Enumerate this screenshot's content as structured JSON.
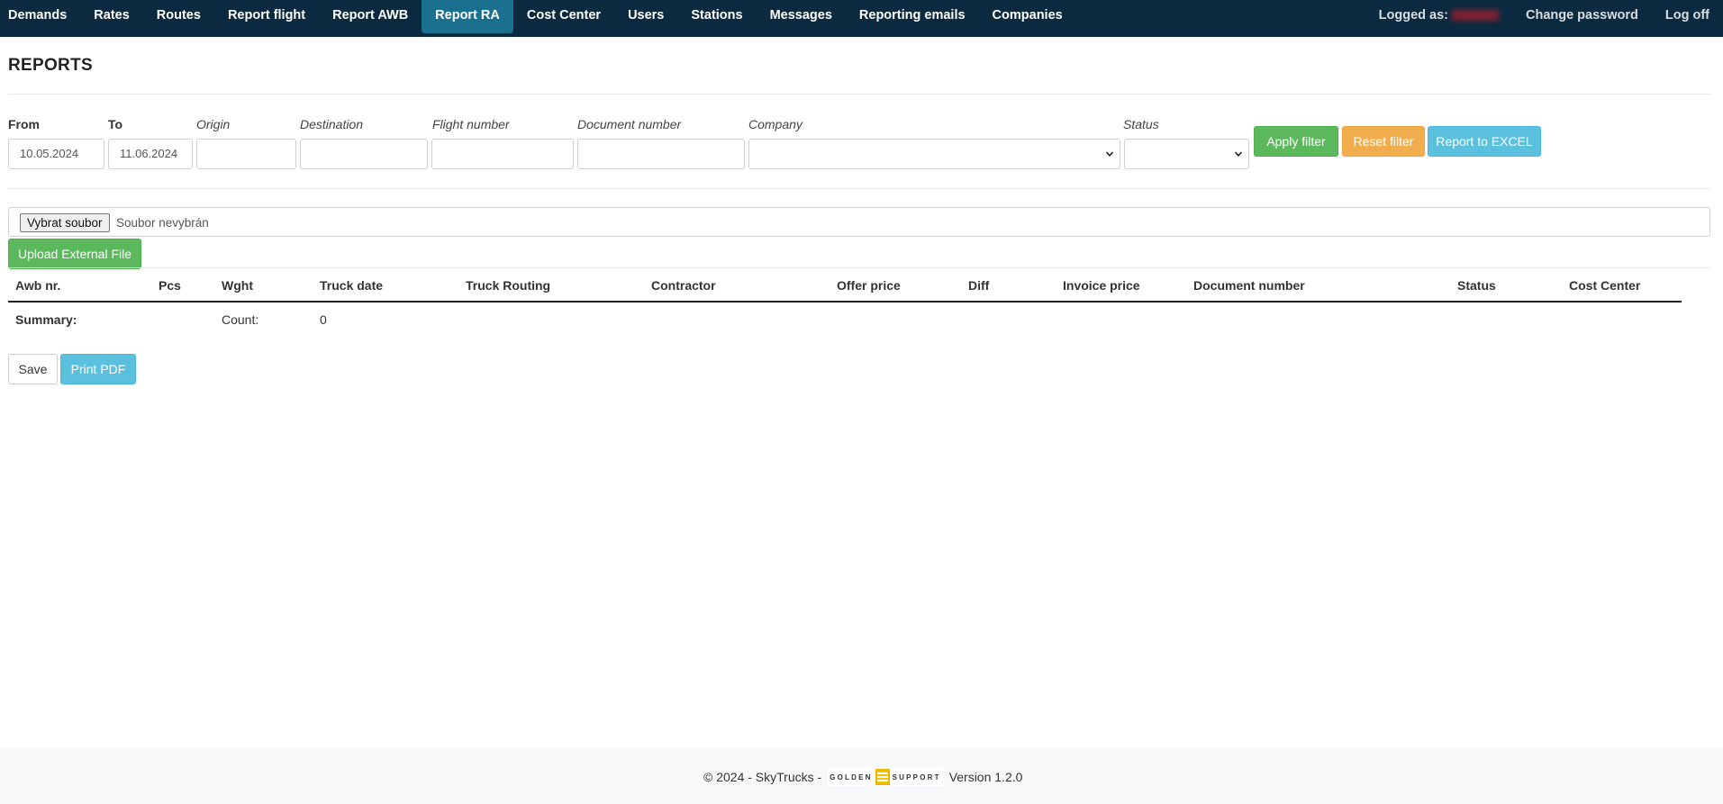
{
  "nav": {
    "items": [
      "Demands",
      "Rates",
      "Routes",
      "Report flight",
      "Report AWB",
      "Report RA",
      "Cost Center",
      "Users",
      "Stations",
      "Messages",
      "Reporting emails",
      "Companies"
    ],
    "active": "Report RA",
    "logged_as": "Logged as:",
    "change_password": "Change password",
    "log_off": "Log off"
  },
  "page_title": "REPORTS",
  "filter": {
    "from_label": "From",
    "to_label": "To",
    "origin_label": "Origin",
    "destination_label": "Destination",
    "flight_number_label": "Flight number",
    "document_number_label": "Document number",
    "company_label": "Company",
    "status_label": "Status",
    "from_value": "10.05.2024",
    "to_value": "11.06.2024",
    "origin_value": "",
    "destination_value": "",
    "flight_number_value": "",
    "document_number_value": "",
    "company_value": "",
    "status_value": "",
    "apply": "Apply filter",
    "reset": "Reset filter",
    "excel": "Report to EXCEL"
  },
  "upload": {
    "choose_file": "Vybrat soubor",
    "no_file": "Soubor nevybrán",
    "upload_button": "Upload External File"
  },
  "table": {
    "columns": [
      "Awb nr.",
      "Pcs",
      "Wght",
      "Truck date",
      "Truck Routing",
      "Contractor",
      "Offer price",
      "Diff",
      "Invoice price",
      "Document number",
      "Status",
      "Cost Center"
    ],
    "summary_label": "Summary:",
    "count_label": "Count:",
    "count_value": "0"
  },
  "actions": {
    "save": "Save",
    "print_pdf": "Print PDF"
  },
  "footer": {
    "copyright": "© 2024 - SkyTrucks -",
    "logo_left": "GOLDEN",
    "logo_right": "SUPPORT",
    "version": "Version 1.2.0"
  },
  "colors": {
    "navbar": "#0c2a3f",
    "nav_active": "#1b6f8f",
    "green": "#5cb85c",
    "orange": "#f0ad4e",
    "blue": "#5bc0de"
  }
}
